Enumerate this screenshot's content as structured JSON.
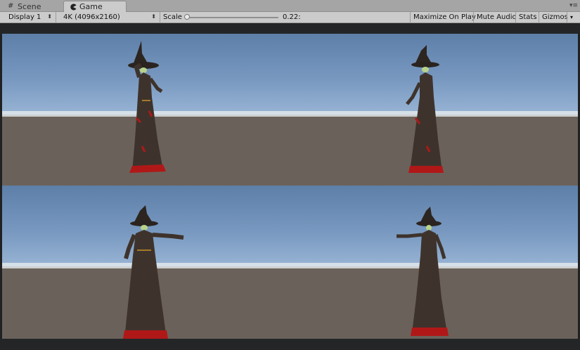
{
  "tabs": [
    {
      "label": "Scene",
      "icon": "grid-hash-icon"
    },
    {
      "label": "Game",
      "icon": "pacman-icon"
    }
  ],
  "toolbar": {
    "display": "Display 1",
    "resolution": "4K (4096x2160)",
    "scale_label": "Scale",
    "scale_value": "0.22:",
    "scale_fraction": 0.0,
    "maximize_on_play": "Maximize On Play",
    "mute_audio": "Mute Audio",
    "stats": "Stats",
    "gizmos": "Gizmos"
  },
  "colors": {
    "sky_top": "#5d7fa8",
    "horizon": "#e9eef1",
    "ground": "#6a625a",
    "robe": "#3e332c",
    "robe_red": "#b01818",
    "skin": "#b8d38a"
  }
}
